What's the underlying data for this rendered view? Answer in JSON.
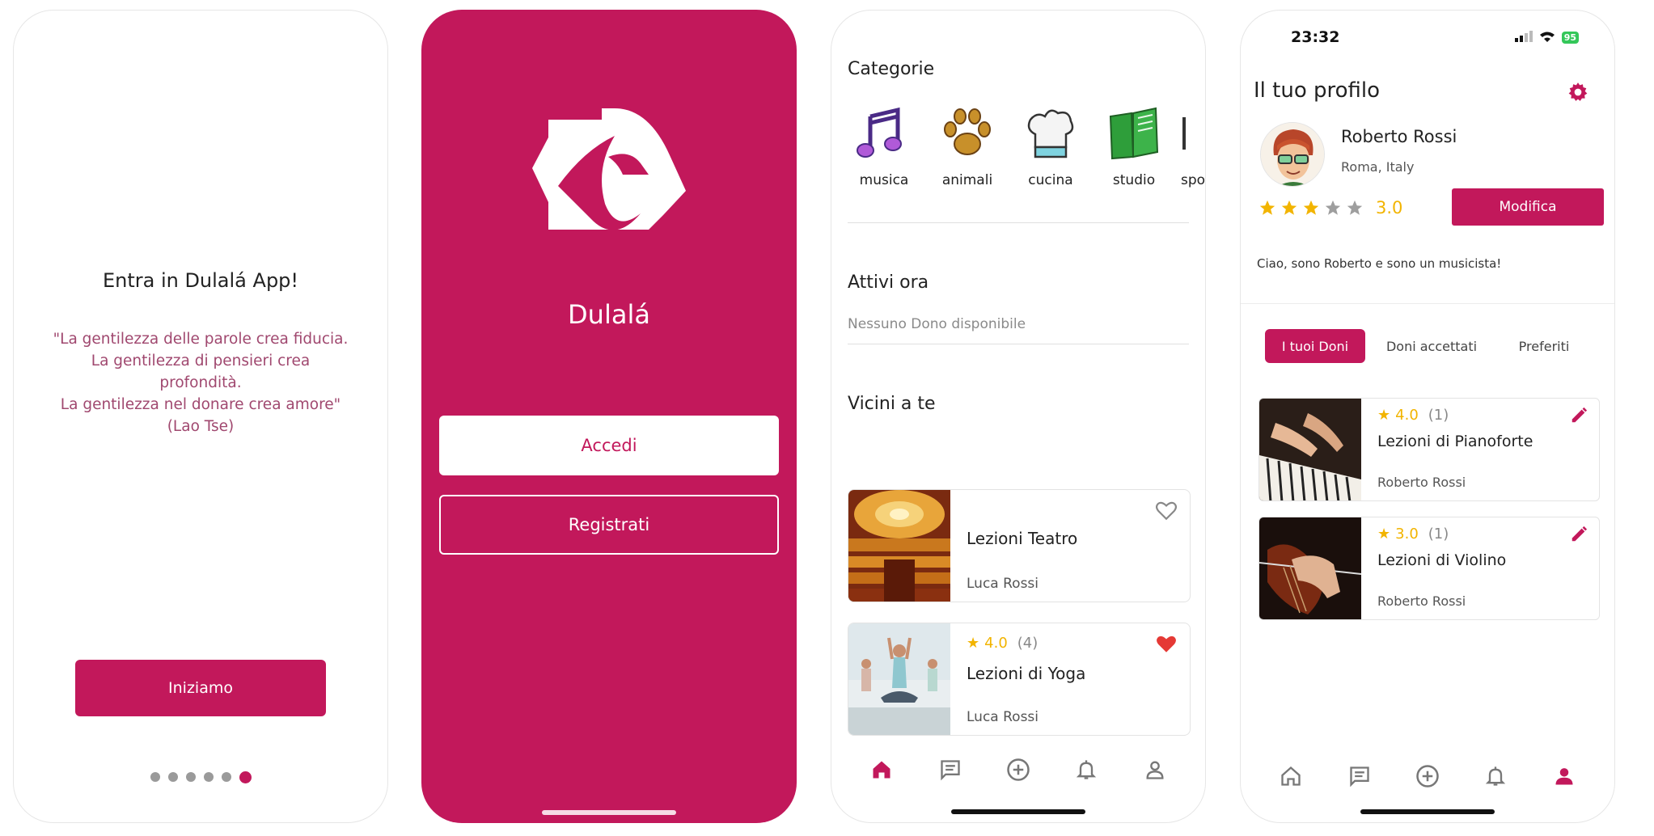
{
  "screen1": {
    "title": "Entra in Dulalá App!",
    "quote_lines": [
      "\"La gentilezza delle parole crea fiducia.",
      "La gentilezza di pensieri crea",
      "profondità.",
      "La gentilezza nel donare crea amore\"",
      "(Lao Tse)"
    ],
    "start_button": "Iniziamo",
    "pager": {
      "total": 6,
      "active_index": 5
    }
  },
  "screen2": {
    "app_name": "Dulalá",
    "login_button": "Accedi",
    "register_button": "Registrati"
  },
  "screen3": {
    "categories_title": "Categorie",
    "categories": [
      {
        "label": "musica",
        "icon": "music-notes-icon"
      },
      {
        "label": "animali",
        "icon": "paw-icon"
      },
      {
        "label": "cucina",
        "icon": "chef-hat-icon"
      },
      {
        "label": "studio",
        "icon": "book-icon"
      },
      {
        "label": "spor",
        "icon": "sport-icon"
      }
    ],
    "active_title": "Attivi ora",
    "active_empty": "Nessuno Dono disponibile",
    "nearby_title": "Vicini a te",
    "cards": [
      {
        "title": "Lezioni Teatro",
        "author": "Luca Rossi",
        "favorite": false
      },
      {
        "title": "Lezioni di Yoga",
        "author": "Luca Rossi",
        "rating": "4.0",
        "count": "(4)",
        "favorite": true
      }
    ],
    "nav": [
      "home-icon",
      "chat-icon",
      "add-circle-icon",
      "bell-icon",
      "user-icon"
    ],
    "nav_active": 0
  },
  "screen4": {
    "status_time": "23:32",
    "battery": "95",
    "title": "Il tuo profilo",
    "name": "Roberto Rossi",
    "location": "Roma, Italy",
    "rating": "3.0",
    "stars_filled": 3,
    "edit_button": "Modifica",
    "bio": "Ciao, sono Roberto e sono un musicista!",
    "tabs": [
      "I tuoi Doni",
      "Doni accettati",
      "Preferiti"
    ],
    "active_tab": 0,
    "gifts": [
      {
        "title": "Lezioni di Pianoforte",
        "author": "Roberto Rossi",
        "rating": "4.0",
        "count": "(1)"
      },
      {
        "title": "Lezioni di Violino",
        "author": "Roberto Rossi",
        "rating": "3.0",
        "count": "(1)"
      }
    ],
    "nav_active": 4
  },
  "colors": {
    "accent": "#c2185b",
    "star": "#f2b400",
    "heart": "#e53935"
  }
}
